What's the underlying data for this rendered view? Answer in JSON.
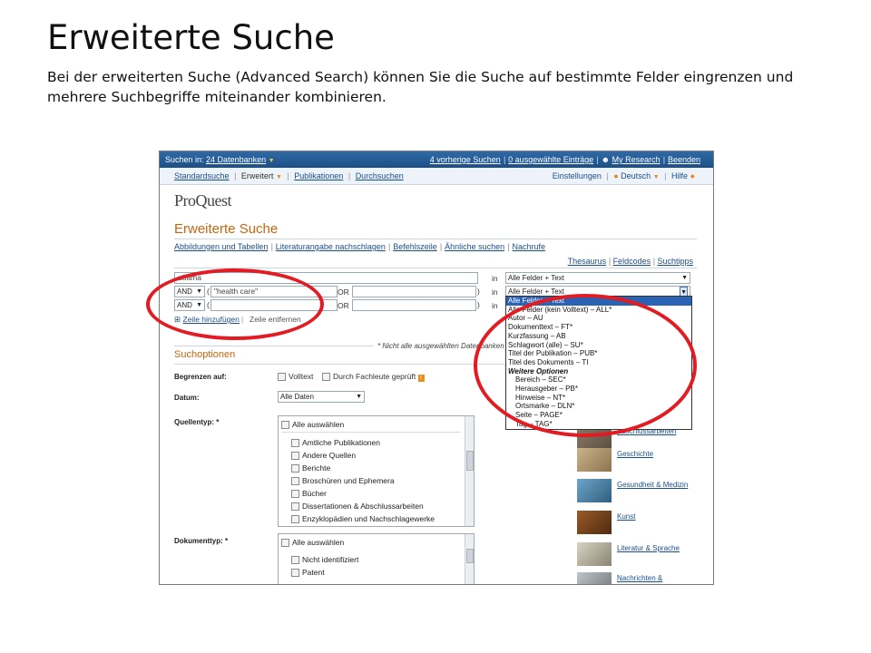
{
  "slide": {
    "title": "Erweiterte Suche",
    "description": "Bei der erweiterten Suche (Advanced Search) können Sie die Suche auf bestimmte Felder eingrenzen und mehrere Suchbegriffe miteinander kombinieren."
  },
  "topbar": {
    "search_in_label": "Suchen in:",
    "databases_link": "24 Datenbanken",
    "recent": "4 vorherige Suchen",
    "selected": "0 ausgewählte Einträge",
    "my_research": "My Research",
    "logout": "Beenden"
  },
  "nav": {
    "standard": "Standardsuche",
    "advanced": "Erweitert",
    "publications": "Publikationen",
    "browse": "Durchsuchen",
    "settings": "Einstellungen",
    "language": "Deutsch",
    "help": "Hilfe"
  },
  "brand": {
    "logo": "ProQuest"
  },
  "page": {
    "title": "Erweiterte Suche"
  },
  "sublinks": [
    "Abbildungen und Tabellen",
    "Literaturangabe nachschlagen",
    "Befehlszeile",
    "Ähnliche suchen",
    "Nachrufe"
  ],
  "tools": {
    "thesaurus": "Thesaurus",
    "fieldcodes": "Feldcodes",
    "tips": "Suchtipps"
  },
  "search_rows": [
    {
      "operator": "",
      "value": "obama",
      "in_label": "in",
      "field": "Alle Felder + Text"
    },
    {
      "operator": "AND",
      "value": "\"health care\"",
      "or_label": "OR",
      "in_label": "in",
      "field": "Alle Felder + Text"
    },
    {
      "operator": "AND",
      "value": "",
      "or_label": "OR",
      "in_label": "in",
      "field": ""
    }
  ],
  "row_actions": {
    "add": "Zeile hinzufügen",
    "remove": "Zeile entfernen"
  },
  "paren_open": "(",
  "paren_close": ")",
  "note": "* Nicht alle ausgewählten Datenbanken",
  "field_dropdown": {
    "items": [
      "Alle Felder + Text",
      "Alle Felder (kein Volltext) – ALL*",
      "Autor – AU",
      "Dokumenttext – FT*",
      "Kurzfassung – AB",
      "Schlagwort (alle) – SU*",
      "Titel der Publikation – PUB*",
      "Titel des Dokuments – TI"
    ],
    "group": "Weitere Optionen",
    "sub_items": [
      "Bereich – SEC*",
      "Herausgeber – PB*",
      "Hinweise – NT*",
      "Ortsmarke – DLN*",
      "Seite – PAGE*",
      "Tag – TAG*"
    ]
  },
  "options": {
    "title": "Suchoptionen",
    "limit_label": "Begrenzen auf:",
    "fulltext": "Volltext",
    "peer": "Durch Fachleute geprüft",
    "date_label": "Datum:",
    "date_value": "Alle Daten",
    "source_label": "Quellentyp: *",
    "select_all": "Alle auswählen",
    "source_types": [
      "Amtliche Publikationen",
      "Andere Quellen",
      "Berichte",
      "Broschüren und Ephemera",
      "Bücher",
      "Dissertationen & Abschlussarbeiten",
      "Enzyklopädien und Nachschlagewerke"
    ],
    "doc_label": "Dokumenttyp: *",
    "doc_types": [
      "Nicht identifiziert",
      "Patent"
    ]
  },
  "sidebar": {
    "items": [
      "Abschlussarbeiten",
      "Geschichte",
      "Gesundheit & Medizin",
      "Kunst",
      "Literatur & Sprache",
      "Nachrichten &"
    ]
  },
  "colors": {
    "topbar": "#1c4f86",
    "accent": "#c8640c",
    "link": "#1a4f8c",
    "highlight_circle": "#e31b23",
    "selection": "#2a62b4"
  }
}
